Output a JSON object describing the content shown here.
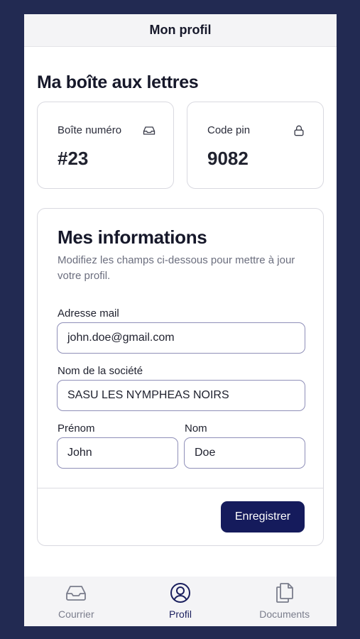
{
  "header": {
    "title": "Mon profil"
  },
  "mailbox": {
    "section_title": "Ma boîte aux lettres",
    "box_label": "Boîte numéro",
    "box_value": "#23",
    "box_icon": "inbox-icon",
    "pin_label": "Code pin",
    "pin_value": "9082",
    "pin_icon": "lock-icon"
  },
  "info": {
    "title": "Mes informations",
    "description": "Modifiez les champs ci-dessous pour mettre à jour votre profil.",
    "email_label": "Adresse mail",
    "email_value": "john.doe@gmail.com",
    "company_label": "Nom de la société",
    "company_value": "SASU LES NYMPHEAS NOIRS",
    "firstname_label": "Prénom",
    "firstname_value": "John",
    "lastname_label": "Nom",
    "lastname_value": "Doe",
    "save_label": "Enregistrer"
  },
  "nav": {
    "items": [
      {
        "label": "Courrier",
        "icon": "inbox-icon",
        "active": false
      },
      {
        "label": "Profil",
        "icon": "user-circle-icon",
        "active": true
      },
      {
        "label": "Documents",
        "icon": "documents-icon",
        "active": false
      }
    ]
  },
  "colors": {
    "background": "#222a52",
    "primary": "#151b5c",
    "field_border": "#8f8fb8"
  }
}
